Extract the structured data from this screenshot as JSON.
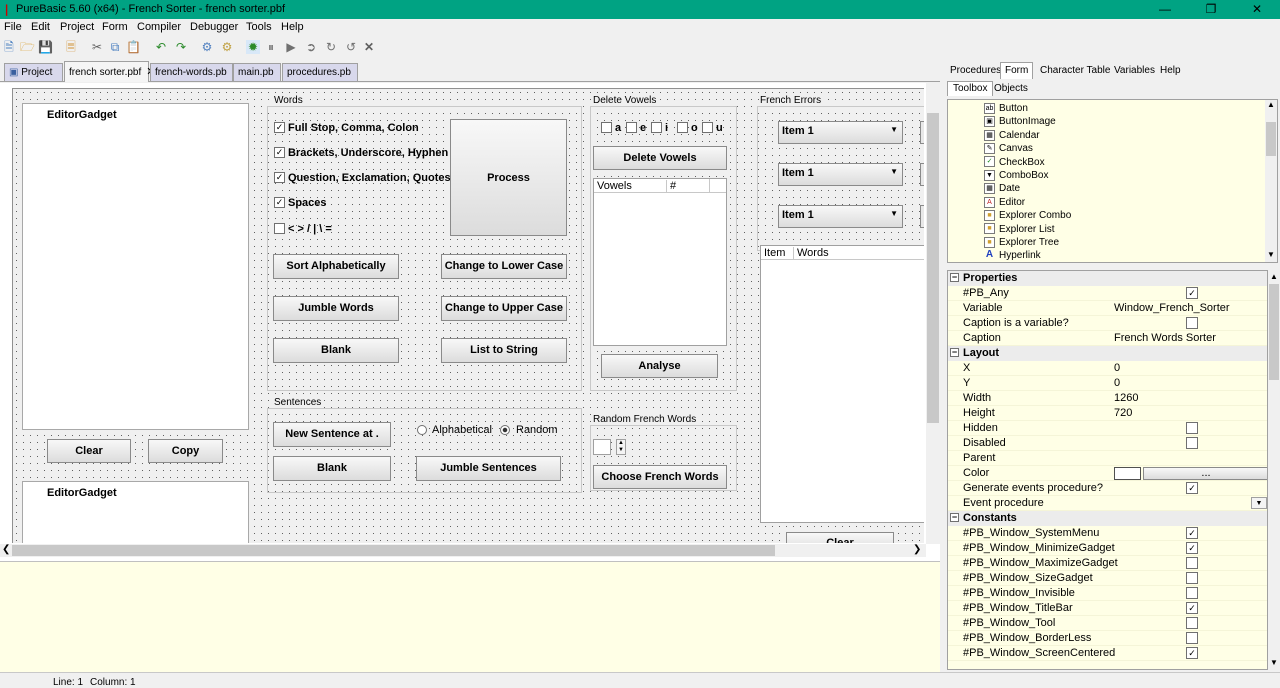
{
  "window": {
    "title": "PureBasic 5.60 (x64) - French Sorter - french sorter.pbf"
  },
  "menu": [
    "File",
    "Edit",
    "Project",
    "Form",
    "Compiler",
    "Debugger",
    "Tools",
    "Help"
  ],
  "toolbar_icons": [
    "new-file-icon",
    "open-file-icon",
    "save-icon",
    "save-all-icon",
    "close-file-icon",
    "cut-icon",
    "copy-icon",
    "paste-icon",
    "undo-icon",
    "redo-icon",
    "compile-icon",
    "build-icon",
    "debug-icon",
    "pause-icon",
    "continue-icon",
    "step-icon",
    "step-over-icon",
    "step-out-icon",
    "kill-icon"
  ],
  "tabs": [
    {
      "label": "Project",
      "closable": false
    },
    {
      "label": "french sorter.pbf",
      "closable": true,
      "active": true
    },
    {
      "label": "french-words.pb",
      "closable": false
    },
    {
      "label": "main.pb",
      "closable": false
    },
    {
      "label": "procedures.pb",
      "closable": false
    }
  ],
  "form": {
    "editor1": "EditorGadget",
    "editor2": "EditorGadget",
    "clear": "Clear",
    "copy": "Copy",
    "words_frame": "Words",
    "chk_fullstop": "Full Stop, Comma, Colon",
    "chk_brackets": "Brackets, Underscore, Hyphen",
    "chk_question": "Question, Exclamation, Quotes",
    "chk_spaces": "Spaces",
    "chk_symbols": "< > / | \\ =",
    "process": "Process",
    "sort_alpha": "Sort Alphabetically",
    "lower": "Change to Lower Case",
    "jumble_words": "Jumble Words",
    "upper": "Change to Upper Case",
    "blank1": "Blank",
    "list_to_string": "List to String",
    "sentences_frame": "Sentences",
    "new_sentence": "New Sentence at .",
    "radio_alpha": "Alphabetical",
    "radio_random": "Random",
    "blank2": "Blank",
    "jumble_sentences": "Jumble Sentences",
    "delete_vowels_frame": "Delete Vowels",
    "vowels": [
      "a",
      "e",
      "i",
      "o",
      "u"
    ],
    "delete_vowels": "Delete Vowels",
    "vowels_col1": "Vowels",
    "vowels_col2": "#",
    "analyse": "Analyse",
    "random_frame": "Random French Words",
    "choose_french": "Choose French Words",
    "errors_frame": "French Errors",
    "combo1": "Item 1",
    "combo2": "Item 1",
    "combo3": "Item 1",
    "list_col1": "Item",
    "list_col2": "Words",
    "clear2": "Clear"
  },
  "right_panel": {
    "tabs": [
      "Procedures",
      "Form",
      "Character Table",
      "Variables",
      "Help"
    ],
    "subtabs": [
      "Toolbox",
      "Objects"
    ],
    "toolbox": [
      "Button",
      "ButtonImage",
      "Calendar",
      "Canvas",
      "CheckBox",
      "ComboBox",
      "Date",
      "Editor",
      "Explorer Combo",
      "Explorer List",
      "Explorer Tree",
      "Hyperlink"
    ],
    "properties_header": "Properties",
    "layout_header": "Layout",
    "constants_header": "Constants",
    "properties": [
      {
        "name": "#PB_Any",
        "check": true
      },
      {
        "name": "Variable",
        "value": "Window_French_Sorter"
      },
      {
        "name": "Caption is a variable?",
        "check": false
      },
      {
        "name": "Caption",
        "value": "French Words Sorter"
      }
    ],
    "layout": [
      {
        "name": "X",
        "value": "0"
      },
      {
        "name": "Y",
        "value": "0"
      },
      {
        "name": "Width",
        "value": "1260"
      },
      {
        "name": "Height",
        "value": "720"
      },
      {
        "name": "Hidden",
        "check": false
      },
      {
        "name": "Disabled",
        "check": false
      },
      {
        "name": "Parent",
        "value": ""
      },
      {
        "name": "Color",
        "value": ""
      },
      {
        "name": "Generate events procedure?",
        "check": true
      },
      {
        "name": "Event procedure",
        "value": ""
      }
    ],
    "constants": [
      {
        "name": "#PB_Window_SystemMenu",
        "check": true
      },
      {
        "name": "#PB_Window_MinimizeGadget",
        "check": true
      },
      {
        "name": "#PB_Window_MaximizeGadget",
        "check": false
      },
      {
        "name": "#PB_Window_SizeGadget",
        "check": false
      },
      {
        "name": "#PB_Window_Invisible",
        "check": false
      },
      {
        "name": "#PB_Window_TitleBar",
        "check": true
      },
      {
        "name": "#PB_Window_Tool",
        "check": false
      },
      {
        "name": "#PB_Window_BorderLess",
        "check": false
      },
      {
        "name": "#PB_Window_ScreenCentered",
        "check": true
      }
    ],
    "color_button": "..."
  },
  "status": {
    "line": "Line: 1",
    "column": "Column: 1"
  }
}
